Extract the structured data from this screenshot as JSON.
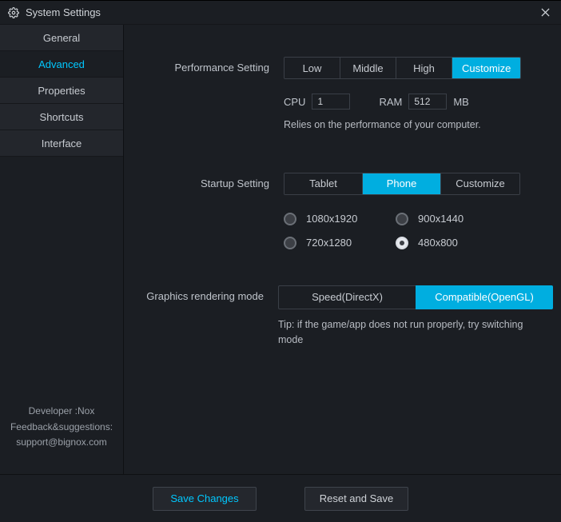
{
  "window": {
    "title": "System Settings"
  },
  "sidebar": {
    "tabs": [
      {
        "label": "General"
      },
      {
        "label": "Advanced"
      },
      {
        "label": "Properties"
      },
      {
        "label": "Shortcuts"
      },
      {
        "label": "Interface"
      }
    ],
    "active_index": 1,
    "info": {
      "line1": "Developer :Nox",
      "line2": "Feedback&suggestions:",
      "line3": "support@bignox.com"
    }
  },
  "performance": {
    "label": "Performance Setting",
    "options": [
      "Low",
      "Middle",
      "High",
      "Customize"
    ],
    "selected_index": 3,
    "cpu_label": "CPU",
    "cpu_value": "1",
    "ram_label": "RAM",
    "ram_value": "512",
    "ram_unit": "MB",
    "hint": "Relies on the performance of your computer."
  },
  "startup": {
    "label": "Startup Setting",
    "options": [
      "Tablet",
      "Phone",
      "Customize"
    ],
    "selected_index": 1,
    "resolutions": [
      "1080x1920",
      "900x1440",
      "720x1280",
      "480x800"
    ],
    "selected_resolution_index": 3
  },
  "rendering": {
    "label": "Graphics rendering mode",
    "options": [
      "Speed(DirectX)",
      "Compatible(OpenGL)"
    ],
    "selected_index": 1,
    "hint": "Tip: if the game/app does not run properly, try switching mode"
  },
  "footer": {
    "save": "Save Changes",
    "reset": "Reset and Save"
  }
}
